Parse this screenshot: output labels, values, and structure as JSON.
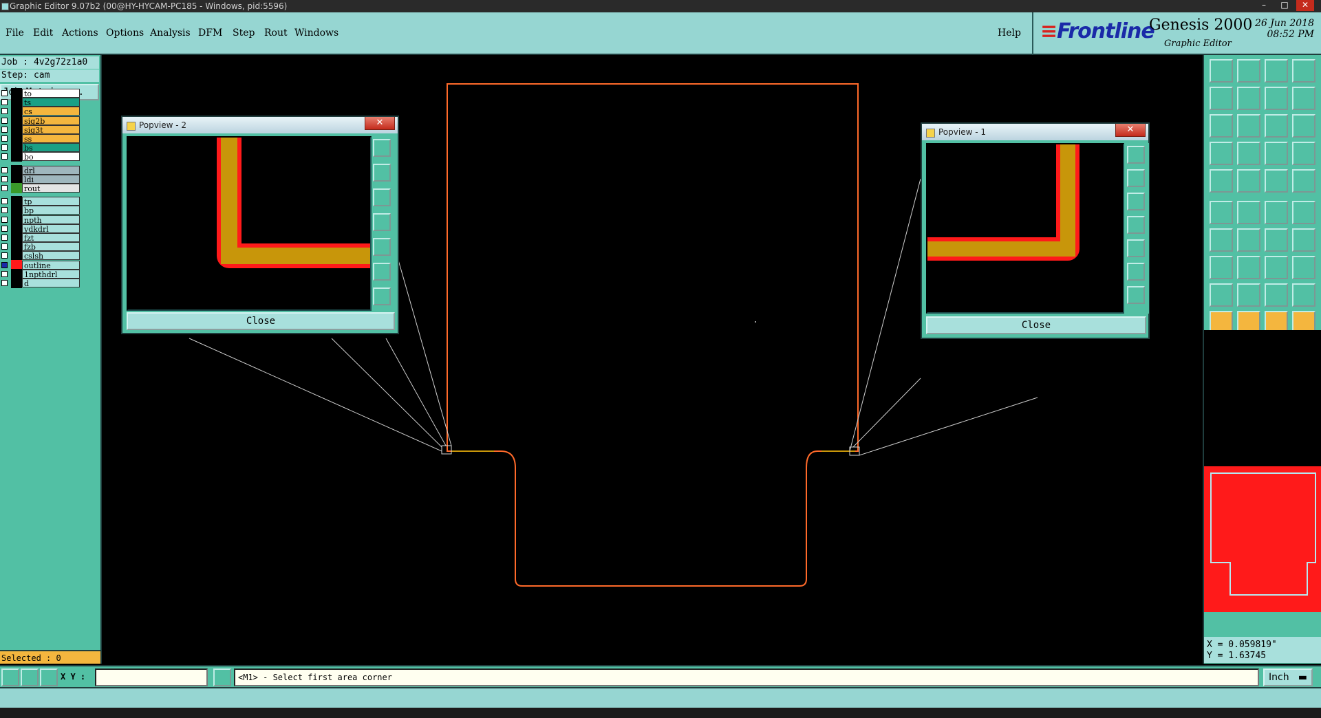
{
  "window": {
    "title": "Graphic Editor 9.07b2 (00@HY-HYCAM-PC185 - Windows, pid:5596)",
    "minimize": "–",
    "maximize": "□",
    "close": "✕"
  },
  "menu": [
    {
      "label": "File"
    },
    {
      "label": "Edit"
    },
    {
      "label": "Actions"
    },
    {
      "label": "Options"
    },
    {
      "label": "Analysis"
    },
    {
      "label": "DFM"
    },
    {
      "label": "Step"
    },
    {
      "label": "Rout"
    },
    {
      "label": "Windows"
    }
  ],
  "help": "Help",
  "brand": {
    "logo": "Frontline",
    "product": "Genesis 2000",
    "subtitle": "Graphic Editor",
    "date": "26 Jun 2018",
    "time": "08:52 PM"
  },
  "job": {
    "job_line": "Job : 4v2g72z1a0",
    "step_line": "Step: cam",
    "matrix_label": "Job Matrix ..."
  },
  "layers": [
    {
      "name": "to",
      "color": "#ffffff"
    },
    {
      "name": "ts",
      "color": "#1aa085"
    },
    {
      "name": "cs",
      "color": "#f4b63e"
    },
    {
      "name": "sig2b",
      "color": "#f4b63e"
    },
    {
      "name": "sig3t",
      "color": "#f4b63e"
    },
    {
      "name": "ss",
      "color": "#f4b63e"
    },
    {
      "name": "bs",
      "color": "#1aa085"
    },
    {
      "name": "bo",
      "color": "#ffffff"
    },
    {
      "name": "drl",
      "color": "#9fb6bd"
    },
    {
      "name": "ldi",
      "color": "#9fb6bd"
    },
    {
      "name": "rout",
      "color": "#e4e4e4"
    },
    {
      "name": "tp",
      "color": "#a8e0dc"
    },
    {
      "name": "bp",
      "color": "#a8e0dc"
    },
    {
      "name": "npth",
      "color": "#a8e0dc"
    },
    {
      "name": "ydkdrl",
      "color": "#a8e0dc"
    },
    {
      "name": "fzt",
      "color": "#a8e0dc"
    },
    {
      "name": "fzb",
      "color": "#a8e0dc"
    },
    {
      "name": "cslsh",
      "color": "#a8e0dc"
    },
    {
      "name": "outline",
      "color": "#a8e0dc"
    },
    {
      "name": "1npthdrl",
      "color": "#a8e0dc"
    },
    {
      "name": "d",
      "color": "#a8e0dc"
    }
  ],
  "selected": "Selected : 0",
  "popviews": [
    {
      "title": "Popview - 2",
      "close_label": "Close",
      "x_glyph": "✕"
    },
    {
      "title": "Popview - 1",
      "close_label": "Close",
      "x_glyph": "✕"
    }
  ],
  "coords": {
    "x": "X = 0.059819\"",
    "y": "Y = 1.63745"
  },
  "bottom": {
    "xy_label": "X Y :",
    "xy_value": "",
    "prompt": "<M1> - Select first area corner",
    "units": "Inch"
  },
  "colors": {
    "panel": "#52c0a4",
    "menubar": "#96d6d2",
    "outline": "#ff6a2a",
    "rout": "#c8960a",
    "highlight": "#ff1a1a"
  }
}
